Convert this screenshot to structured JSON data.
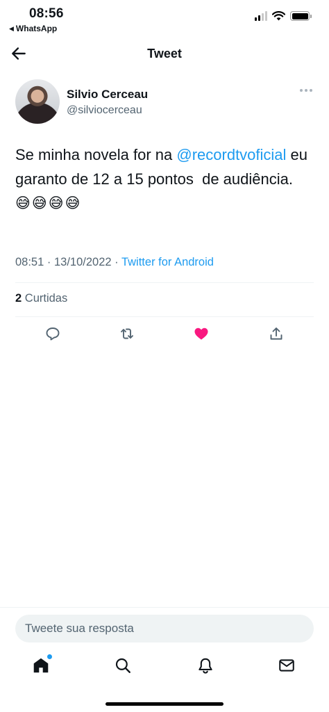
{
  "status_bar": {
    "time": "08:56",
    "back_app": "WhatsApp"
  },
  "header": {
    "title": "Tweet"
  },
  "tweet": {
    "author_name": "Silvio Cerceau",
    "author_handle": "@silviocerceau",
    "text_before": "Se minha novela for na ",
    "mention": "@recordtvoficial",
    "text_after": " eu garanto de 12 a 15 pontos  de audiência.",
    "emojis": "😅😅😅😅",
    "time": "08:51",
    "date": "13/10/2022",
    "separator": "·",
    "source": "Twitter for Android",
    "likes_count": "2",
    "likes_label": "Curtidas",
    "liked": true
  },
  "actions": [
    {
      "name": "reply-button",
      "icon": "comment-icon"
    },
    {
      "name": "retweet-button",
      "icon": "retweet-icon"
    },
    {
      "name": "like-button",
      "icon": "heart-icon",
      "color": "#f91880"
    },
    {
      "name": "share-button",
      "icon": "share-icon"
    }
  ],
  "reply": {
    "placeholder": "Tweete sua resposta"
  },
  "bottom_nav": [
    {
      "name": "home",
      "icon": "home-icon",
      "active": true,
      "badge_color": "#1d9bf0"
    },
    {
      "name": "search",
      "icon": "search-icon"
    },
    {
      "name": "notifications",
      "icon": "bell-icon"
    },
    {
      "name": "messages",
      "icon": "mail-icon"
    }
  ],
  "colors": {
    "accent": "#1d9bf0",
    "like": "#f91880",
    "secondary_text": "#536471"
  }
}
